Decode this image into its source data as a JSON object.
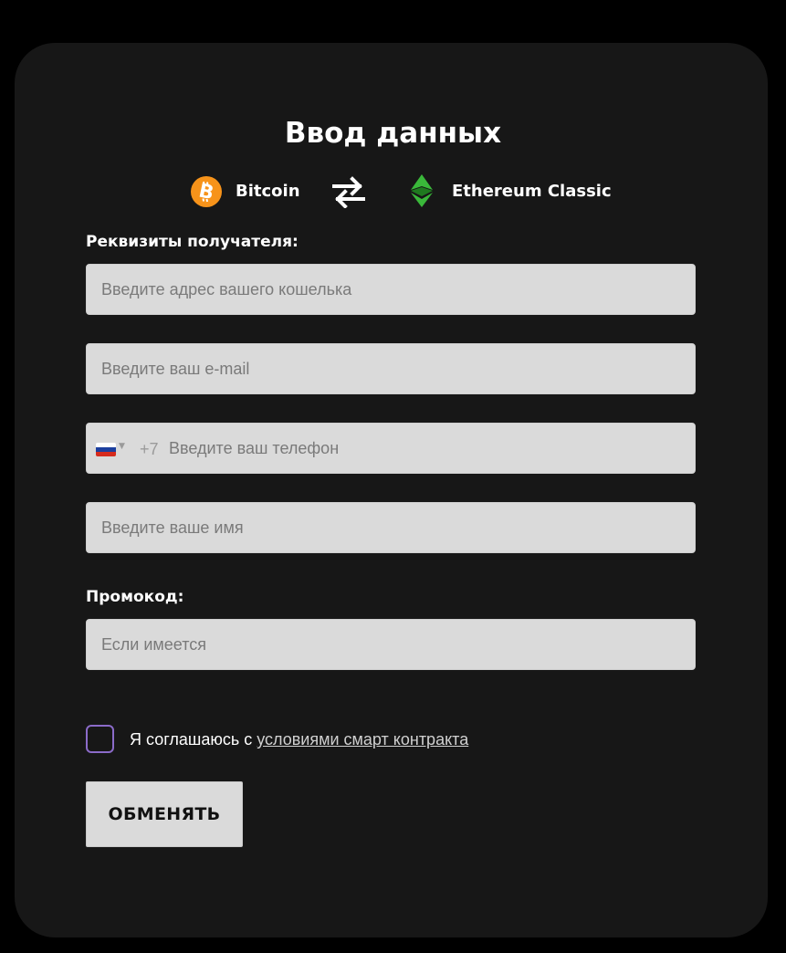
{
  "form": {
    "title": "Ввод данных",
    "from_coin": {
      "label": "Bitcoin",
      "icon": "bitcoin-icon",
      "color": "#f7931a"
    },
    "to_coin": {
      "label": "Ethereum Classic",
      "icon": "ethereum-classic-icon",
      "color": "#3ab83a"
    },
    "swap_icon": "swap-arrows-icon",
    "recipient_label": "Реквизиты получателя:",
    "wallet_placeholder": "Введите адрес вашего кошелька",
    "email_placeholder": "Введите ваш e-mail",
    "phone": {
      "country_flag": "ru-flag-icon",
      "dial_code": "+7",
      "placeholder": "Введите ваш телефон"
    },
    "name_placeholder": "Введите ваше имя",
    "promo_label": "Промокод:",
    "promo_placeholder": "Если имеется",
    "agree_text": "Я соглашаюсь с ",
    "agree_link": "условиями смарт контракта",
    "submit_label": "ОБМЕНЯТЬ"
  },
  "colors": {
    "background": "#000000",
    "card": "#171717",
    "field": "#dadada",
    "checkbox_border": "#8b6bc9"
  }
}
